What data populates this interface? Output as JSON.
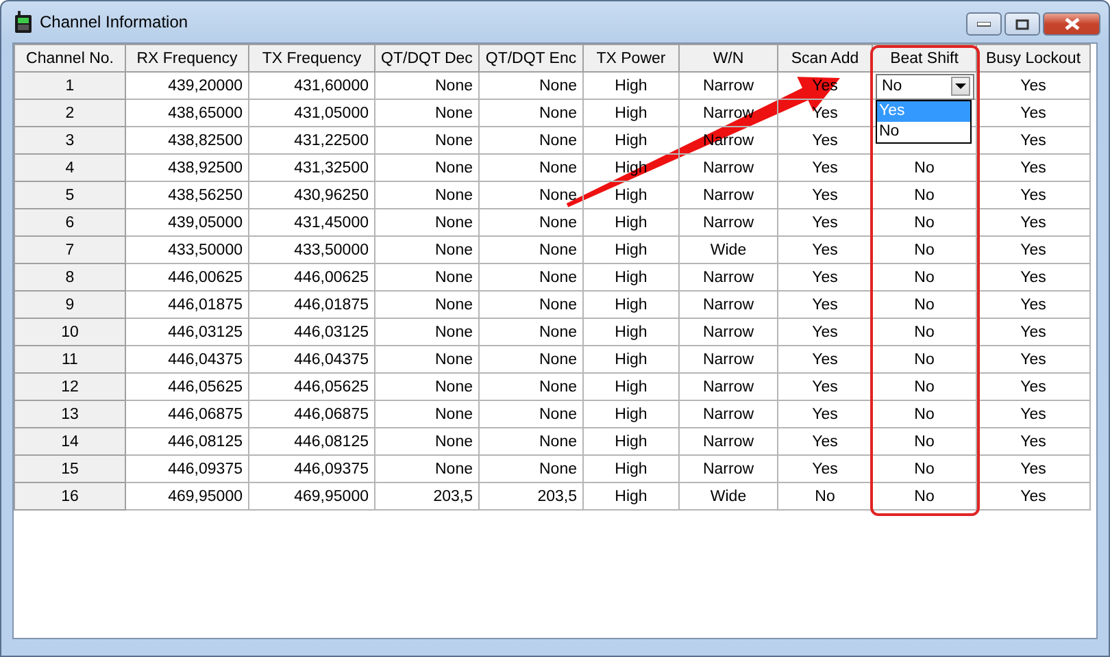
{
  "window": {
    "title": "Channel Information"
  },
  "table": {
    "columns": [
      {
        "label": "Channel No.",
        "kind": "row_header"
      },
      {
        "label": "RX Frequency",
        "kind": "number"
      },
      {
        "label": "TX Frequency",
        "kind": "number"
      },
      {
        "label": "QT/DQT Dec",
        "kind": "number"
      },
      {
        "label": "QT/DQT Enc",
        "kind": "number"
      },
      {
        "label": "TX Power",
        "kind": "text"
      },
      {
        "label": "W/N",
        "kind": "text"
      },
      {
        "label": "Scan Add",
        "kind": "text"
      },
      {
        "label": "Beat Shift",
        "kind": "choice"
      },
      {
        "label": "Busy Lockout",
        "kind": "text"
      }
    ],
    "rows": [
      {
        "cells": [
          "1",
          "439,20000",
          "431,60000",
          "None",
          "None",
          "High",
          "Narrow",
          "Yes",
          "No",
          "Yes"
        ],
        "dropdown": {
          "options": [
            {
              "label": "Yes",
              "selected": true
            },
            {
              "label": "No",
              "selected": false
            }
          ]
        }
      },
      {
        "cells": [
          "2",
          "438,65000",
          "431,05000",
          "None",
          "None",
          "High",
          "Narrow",
          "Yes",
          null,
          "Yes"
        ]
      },
      {
        "cells": [
          "3",
          "438,82500",
          "431,22500",
          "None",
          "None",
          "High",
          "Narrow",
          "Yes",
          null,
          "Yes"
        ]
      },
      {
        "cells": [
          "4",
          "438,92500",
          "431,32500",
          "None",
          "None",
          "High",
          "Narrow",
          "Yes",
          "No",
          "Yes"
        ]
      },
      {
        "cells": [
          "5",
          "438,56250",
          "430,96250",
          "None",
          "None",
          "High",
          "Narrow",
          "Yes",
          "No",
          "Yes"
        ]
      },
      {
        "cells": [
          "6",
          "439,05000",
          "431,45000",
          "None",
          "None",
          "High",
          "Narrow",
          "Yes",
          "No",
          "Yes"
        ]
      },
      {
        "cells": [
          "7",
          "433,50000",
          "433,50000",
          "None",
          "None",
          "High",
          "Wide",
          "Yes",
          "No",
          "Yes"
        ]
      },
      {
        "cells": [
          "8",
          "446,00625",
          "446,00625",
          "None",
          "None",
          "High",
          "Narrow",
          "Yes",
          "No",
          "Yes"
        ]
      },
      {
        "cells": [
          "9",
          "446,01875",
          "446,01875",
          "None",
          "None",
          "High",
          "Narrow",
          "Yes",
          "No",
          "Yes"
        ]
      },
      {
        "cells": [
          "10",
          "446,03125",
          "446,03125",
          "None",
          "None",
          "High",
          "Narrow",
          "Yes",
          "No",
          "Yes"
        ]
      },
      {
        "cells": [
          "11",
          "446,04375",
          "446,04375",
          "None",
          "None",
          "High",
          "Narrow",
          "Yes",
          "No",
          "Yes"
        ]
      },
      {
        "cells": [
          "12",
          "446,05625",
          "446,05625",
          "None",
          "None",
          "High",
          "Narrow",
          "Yes",
          "No",
          "Yes"
        ]
      },
      {
        "cells": [
          "13",
          "446,06875",
          "446,06875",
          "None",
          "None",
          "High",
          "Narrow",
          "Yes",
          "No",
          "Yes"
        ]
      },
      {
        "cells": [
          "14",
          "446,08125",
          "446,08125",
          "None",
          "None",
          "High",
          "Narrow",
          "Yes",
          "No",
          "Yes"
        ]
      },
      {
        "cells": [
          "15",
          "446,09375",
          "446,09375",
          "None",
          "None",
          "High",
          "Narrow",
          "Yes",
          "No",
          "Yes"
        ]
      },
      {
        "cells": [
          "16",
          "469,95000",
          "469,95000",
          "203,5",
          "203,5",
          "High",
          "Wide",
          "No",
          "No",
          "Yes"
        ]
      }
    ]
  }
}
